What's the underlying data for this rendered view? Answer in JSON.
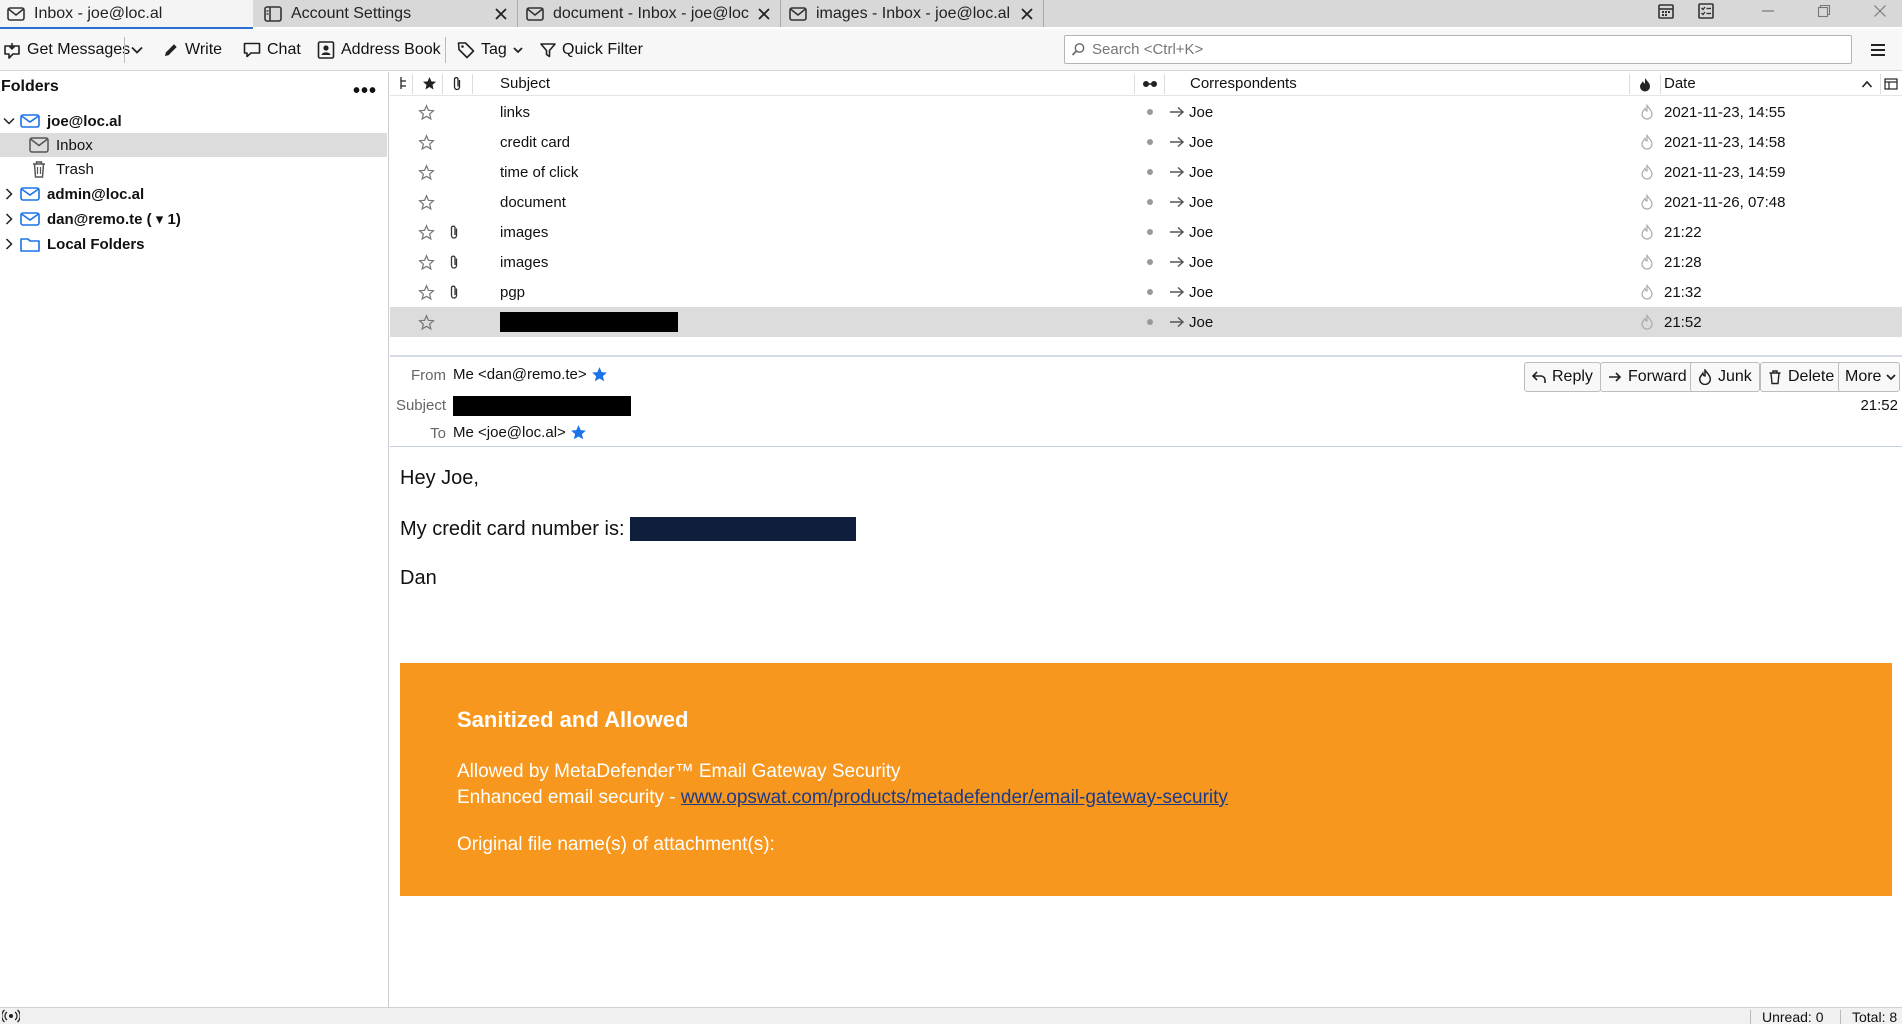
{
  "tabs": [
    {
      "label": "Inbox - joe@loc.al",
      "icon": "mail-icon",
      "active": true
    },
    {
      "label": "Account Settings",
      "icon": "settings-panel-icon",
      "active": false
    },
    {
      "label": "document - Inbox - joe@loc",
      "icon": "mail-icon",
      "active": false
    },
    {
      "label": "images - Inbox - joe@loc.al",
      "icon": "mail-icon",
      "active": false
    }
  ],
  "toolbar": {
    "get_messages": "Get Messages",
    "write": "Write",
    "chat": "Chat",
    "address_book": "Address Book",
    "tag": "Tag",
    "quick_filter": "Quick Filter",
    "search_placeholder": "Search <Ctrl+K>"
  },
  "folders": {
    "title": "Folders",
    "accounts": [
      {
        "label": "joe@loc.al",
        "expanded": true
      },
      {
        "label": "Inbox"
      },
      {
        "label": "Trash"
      },
      {
        "label": "admin@loc.al",
        "expanded": false
      },
      {
        "label": "dan@remo.te ( ▾ 1)",
        "expanded": false
      },
      {
        "label": "Local Folders",
        "expanded": false
      }
    ]
  },
  "threads": {
    "columns": {
      "subject": "Subject",
      "correspondents": "Correspondents",
      "date": "Date"
    },
    "rows": [
      {
        "subject": "links",
        "correspondent": "Joe",
        "date": "2021-11-23, 14:55",
        "attachment": false
      },
      {
        "subject": "credit card",
        "correspondent": "Joe",
        "date": "2021-11-23, 14:58",
        "attachment": false
      },
      {
        "subject": "time of click",
        "correspondent": "Joe",
        "date": "2021-11-23, 14:59",
        "attachment": false
      },
      {
        "subject": "document",
        "correspondent": "Joe",
        "date": "2021-11-26, 07:48",
        "attachment": false
      },
      {
        "subject": "images",
        "correspondent": "Joe",
        "date": "21:22",
        "attachment": true
      },
      {
        "subject": "images",
        "correspondent": "Joe",
        "date": "21:28",
        "attachment": true
      },
      {
        "subject": "pgp",
        "correspondent": "Joe",
        "date": "21:32",
        "attachment": true
      },
      {
        "subject": "",
        "correspondent": "Joe",
        "date": "21:52",
        "attachment": false,
        "redacted": true,
        "selected": true
      }
    ]
  },
  "message": {
    "from_label": "From",
    "from_value": "Me <dan@remo.te>",
    "subject_label": "Subject",
    "to_label": "To",
    "to_value": "Me <joe@loc.al>",
    "time": "21:52",
    "buttons": {
      "reply": "Reply",
      "forward": "Forward",
      "junk": "Junk",
      "delete": "Delete",
      "more": "More"
    },
    "body": {
      "greeting": "Hey Joe,",
      "line": "My credit card number is:",
      "signoff": "Dan"
    },
    "banner": {
      "title": "Sanitized and Allowed",
      "line1": "Allowed by MetaDefender™ Email Gateway Security",
      "line2_prefix": "Enhanced email security - ",
      "link": "www.opswat.com/products/metadefender/email-gateway-security",
      "line3": "Original file name(s) of attachment(s):",
      "color": "#f7971e"
    }
  },
  "status": {
    "unread": "Unread: 0",
    "total": "Total: 8"
  }
}
